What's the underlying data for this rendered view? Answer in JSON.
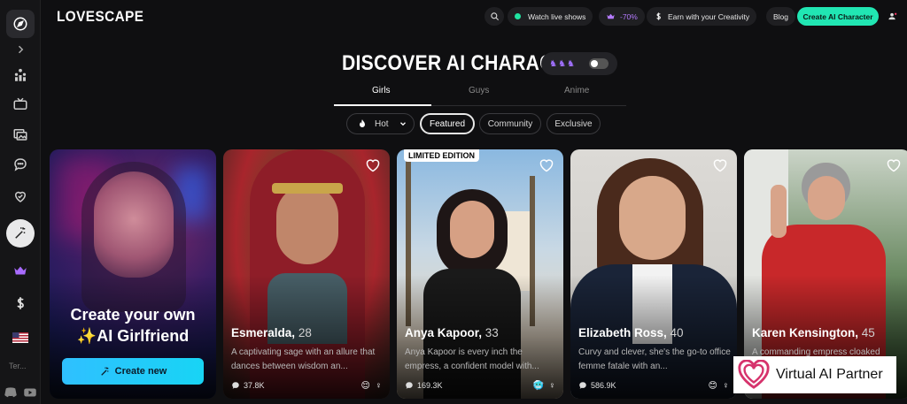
{
  "header": {
    "logo": "LOVESCAPE",
    "watch_live": "Watch live shows",
    "promo": "-70%",
    "earn": "Earn with your Creativity",
    "blog": "Blog",
    "create_cta": "Create AI Character"
  },
  "sidebar": {
    "language_hint": "Ter..."
  },
  "discover": {
    "title": "DISCOVER AI CHARACTERS",
    "tabs": [
      "Girls",
      "Guys",
      "Anime"
    ],
    "filters": {
      "sort": "Hot",
      "chips": [
        "Featured",
        "Community",
        "Exclusive"
      ]
    }
  },
  "create_card": {
    "line1": "Create your own",
    "line2": "✨AI Girlfriend",
    "button": "Create new"
  },
  "cards": [
    {
      "name": "Esmeralda,",
      "age": "28",
      "desc": "A captivating sage with an allure that dances between wisdom an...",
      "count": "37.8K",
      "emoji": "😌",
      "gender": "♀"
    },
    {
      "name": "Anya Kapoor,",
      "age": "33",
      "desc": "Anya Kapoor is every inch the empress, a confident model with...",
      "count": "169.3K",
      "emoji": "🥶",
      "gender": "♀",
      "badge": "LIMITED EDITION"
    },
    {
      "name": "Elizabeth Ross,",
      "age": "40",
      "desc": "Curvy and clever, she's the go-to office femme fatale with an...",
      "count": "586.9K",
      "emoji": "😊",
      "gender": "♀"
    },
    {
      "name": "Karen Kensington,",
      "age": "45",
      "desc": "A commanding empress cloaked",
      "count": "",
      "emoji": "",
      "gender": ""
    }
  ],
  "partner": {
    "label": "Virtual AI Partner"
  }
}
